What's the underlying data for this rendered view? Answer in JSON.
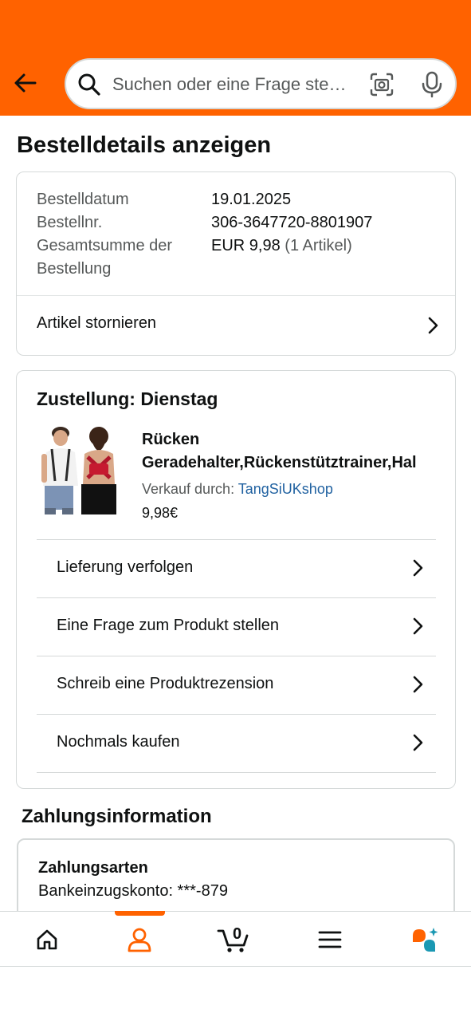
{
  "header": {
    "search_placeholder": "Suchen oder eine Frage ste…"
  },
  "page": {
    "title": "Bestelldetails anzeigen"
  },
  "order_info": {
    "date_label": "Bestelldatum",
    "date_value": "19.01.2025",
    "number_label": "Bestellnr.",
    "number_value": "306-3647720-8801907",
    "total_label_line1": "Gesamtsumme der",
    "total_label_line2": "Bestellung",
    "total_value": "EUR 9,98",
    "total_items": "(1 Artikel)",
    "cancel_label": "Artikel stornieren"
  },
  "delivery": {
    "title": "Zustellung: Dienstag",
    "product_name_line1": "Rücken",
    "product_name_line2": "Geradehalter,Rückenstütztrainer,Hal",
    "seller_prefix": "Verkauf durch:",
    "seller_name": "TangSiUKshop",
    "price": "9,98€",
    "actions": [
      {
        "label": "Lieferung verfolgen"
      },
      {
        "label": "Eine Frage zum Produkt stellen"
      },
      {
        "label": "Schreib eine Produktrezension"
      },
      {
        "label": "Nochmals kaufen"
      }
    ]
  },
  "payment": {
    "title": "Zahlungsinformation",
    "methods_label": "Zahlungsarten",
    "account": "Bankeinzugskonto: ***-879"
  },
  "tabbar": {
    "cart_count": "0",
    "active_tab": "account"
  },
  "colors": {
    "brand": "#ff6200",
    "link": "#2162a1"
  }
}
